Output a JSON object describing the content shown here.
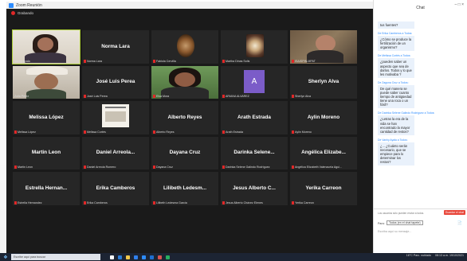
{
  "window": {
    "title": "Zoom Reunión",
    "recording": "Grabando"
  },
  "tiles": [
    {
      "name": "",
      "label": "Vanhy Ayala",
      "kind": "video",
      "speaking": true
    },
    {
      "name": "Norma Lara",
      "label": "Norma Lara",
      "kind": "name"
    },
    {
      "name": "",
      "label": "Fabiola Cervilla",
      "kind": "image"
    },
    {
      "name": "",
      "label": "Martha Dinas Solís",
      "kind": "image"
    },
    {
      "name": "",
      "label": "ISAISPIN-MPAT",
      "kind": "video"
    },
    {
      "name": "",
      "label": "Zoila Pérez",
      "kind": "video"
    },
    {
      "name": "José Luis Perea",
      "label": "José Luis Perea",
      "kind": "name"
    },
    {
      "name": "",
      "label": "Elsa Mora",
      "kind": "video"
    },
    {
      "name": "A",
      "label": "ARIANA ALVAREZ",
      "kind": "avatar"
    },
    {
      "name": "Sherlyn Alva",
      "label": "Sherlyn Alva",
      "kind": "name"
    },
    {
      "name": "Melissa López",
      "label": "Melissa López",
      "kind": "name"
    },
    {
      "name": "",
      "label": "Melissa Cortés",
      "kind": "image"
    },
    {
      "name": "Alberto Reyes",
      "label": "Alberto Reyes",
      "kind": "name"
    },
    {
      "name": "Arath Estrada",
      "label": "Arath Estrada",
      "kind": "name"
    },
    {
      "name": "Aylin Moreno",
      "label": "Aylin Moreno",
      "kind": "name"
    },
    {
      "name": "Martin Leon",
      "label": "Martin Leon",
      "kind": "name"
    },
    {
      "name": "Daniel Arreola...",
      "label": "Daniel Arreola Romero",
      "kind": "name"
    },
    {
      "name": "Dayana Cruz",
      "label": "Dayana Cruz",
      "kind": "name"
    },
    {
      "name": "Darinka Selene...",
      "label": "Darinka Selene Galindo Rodríguez",
      "kind": "name"
    },
    {
      "name": "Angélica Elizabe...",
      "label": "Angélica Elizabeth Valenzuela Agui...",
      "kind": "name"
    },
    {
      "name": "Estrella Hernan...",
      "label": "Estrella Hernandez",
      "kind": "name"
    },
    {
      "name": "Erika Camberos",
      "label": "Erika Camberos",
      "kind": "name"
    },
    {
      "name": "Lilibeth Ledesm...",
      "label": "Lilibeth Ledesma Garcia",
      "kind": "name"
    },
    {
      "name": "Jesus Alberto C...",
      "label": "Jesus Alberto Chávez Elenes",
      "kind": "name"
    },
    {
      "name": "Yerika Carreon",
      "label": "Yerika Carreon",
      "kind": "name"
    }
  ],
  "chat": {
    "title": "Chat",
    "messages": [
      {
        "from": "",
        "text": "tus fuentes?"
      },
      {
        "from": "De Erika Camberos a Todos:",
        "text": "¿Cómo se produce la fertilización de un organismo?"
      },
      {
        "from": "De Melissa Cortés a Todos:",
        "text": "¿pueden saber un aspecto que sea de darlos. Todos y lo que les motivaba ?"
      },
      {
        "from": "De Zaguna Cruz a Todos:",
        "text": "De qué manera se puede saber cuanto tiempo de antigüedad tiene una roca o un fósil?"
      },
      {
        "from": "De Darinka Selene Galindo Rodríguez a Todos:",
        "text": "¿Letras la era de la vida se han encontrado la mayor cantidad de restos?"
      },
      {
        "from": "De Vanhy Ayala a Todos:",
        "text": "¿... ¿Cuánto serán necesario, que se empiece para lo determinar los restos?"
      }
    ],
    "hint": "Los usuarios sólo pueden enviar a todos.",
    "button": "Guardar el chat",
    "to_label": "Para:",
    "to_value": "Todos (en el chat tapete)",
    "placeholder": "Escriba aquí su mensaje..."
  },
  "taskbar": {
    "search": "Escribe aquí para buscar",
    "weather": "16°C Parc. nublado",
    "time": "08:13 a.m.",
    "date": "19/10/2021"
  }
}
